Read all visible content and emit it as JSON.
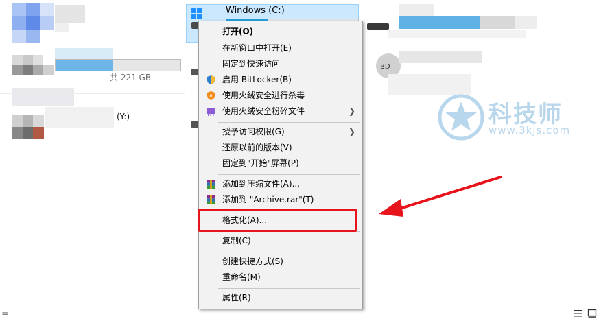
{
  "drive": {
    "title": "Windows (C:)",
    "usage_fraction": 0.32
  },
  "left_panel": {
    "size_text": "共 221 GB",
    "drive_letter_text": "(Y:)"
  },
  "context_menu": {
    "items": [
      {
        "label": "打开(O)",
        "bold": true
      },
      {
        "label": "在新窗口中打开(E)"
      },
      {
        "label": "固定到快速访问"
      },
      {
        "label": "启用 BitLocker(B)",
        "icon": "shield-icon"
      },
      {
        "label": "使用火绒安全进行杀毒",
        "icon": "huorong-icon"
      },
      {
        "label": "使用火绒安全粉碎文件",
        "icon": "shredder-icon",
        "submenu": true
      },
      {
        "label": "授予访问权限(G)",
        "submenu": true
      },
      {
        "label": "还原以前的版本(V)"
      },
      {
        "label": "固定到\"开始\"屏幕(P)"
      },
      {
        "label": "添加到压缩文件(A)...",
        "icon": "winrar-icon"
      },
      {
        "label": "添加到 \"Archive.rar\"(T)",
        "icon": "winrar-icon"
      },
      {
        "label": "格式化(A)..."
      },
      {
        "label": "复制(C)"
      },
      {
        "label": "创建快捷方式(S)"
      },
      {
        "label": "重命名(M)"
      },
      {
        "label": "属性(R)"
      }
    ]
  },
  "watermark": {
    "name": "科技师",
    "url": "www.3kjs.com"
  },
  "colors": {
    "highlight_box": "#e8141c",
    "arrow": "#e8141c",
    "selection": "#cce8ff",
    "bar_fill": "#26a0da"
  }
}
